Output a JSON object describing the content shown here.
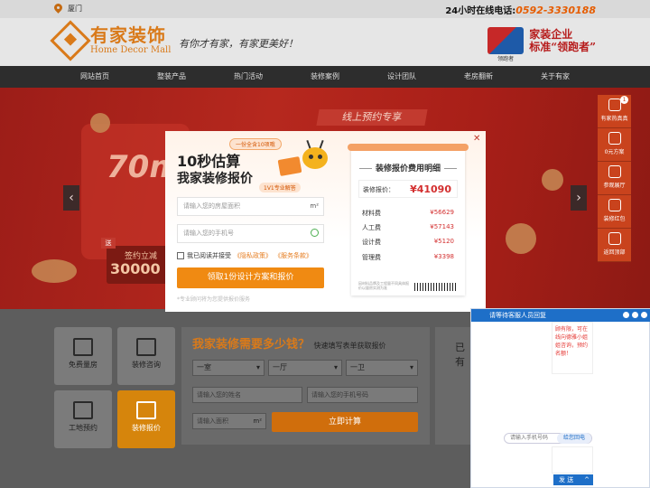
{
  "topbar": {
    "city": "厦门",
    "hotline_label": "24小时在线电话:",
    "hotline_number": "0592-3330188"
  },
  "header": {
    "logo_cn": "有家装饰",
    "logo_en": "Home Decor Mall",
    "slogan": "有你才有家，有家更美好！",
    "badge_caption": "领跑者",
    "badge_line1": "家装企业",
    "badge_line2": "标准“领跑者”"
  },
  "nav": [
    "网站首页",
    "整装产品",
    "热门活动",
    "装修案例",
    "设计团队",
    "老房翻新",
    "关于有家"
  ],
  "banner": {
    "headline": "线上预约专享",
    "big": "70m",
    "sign_small": "签约立减",
    "sign_big": "30000",
    "tag": "送"
  },
  "floatbar": [
    {
      "label": "有家热真真",
      "badge": "1",
      "icon": "headset-icon"
    },
    {
      "label": "0元方案",
      "icon": "edit-icon"
    },
    {
      "label": "参观展厅",
      "icon": "location-icon"
    },
    {
      "label": "装修红包",
      "icon": "gift-icon"
    },
    {
      "label": "返回顶部",
      "icon": "arrow-up-icon"
    }
  ],
  "modal": {
    "tag_top": "一份全含10项哦",
    "title1": "10秒估算",
    "title2": "我家装修报价",
    "tag_expert": "1V1专业解答",
    "area_placeholder": "请输入您的房屋面积",
    "area_unit": "m²",
    "phone_placeholder": "请输入您的手机号",
    "agree_prefix": "我已阅读并接受",
    "privacy": "《隐私政策》",
    "service": "《服务条款》",
    "button": "领取1份设计方案和报价",
    "note": "*专业顾问将为您提供报价服务",
    "receipt": {
      "heading": "装修报价费用明细",
      "quote_label": "装修报价：",
      "quote_value": "¥41090",
      "rows": [
        {
          "label": "材料费",
          "value": "¥56629"
        },
        {
          "label": "人工费",
          "value": "¥57143"
        },
        {
          "label": "设计费",
          "value": "¥5120"
        },
        {
          "label": "管理费",
          "value": "¥3398"
        }
      ],
      "fine_print": "因材料品牌及工程量不同具体报价以量房实测为准"
    }
  },
  "tiles": [
    {
      "label": "免费量房",
      "icon": "house-measure-icon"
    },
    {
      "label": "装修咨询",
      "icon": "consult-icon"
    },
    {
      "label": "工地预约",
      "icon": "construction-icon"
    },
    {
      "label": "装修报价",
      "icon": "yen-icon"
    }
  ],
  "calc": {
    "title": "我家装修需要多少钱？",
    "subtitle": "快速填写表单获取报价",
    "selects": [
      "一室",
      "一厅",
      "一卫"
    ],
    "name_placeholder": "请输入您的姓名",
    "phone_placeholder": "请输入您的手机号码",
    "area_placeholder": "请输入面积",
    "area_unit": "m²",
    "button": "立即计算"
  },
  "side_title": "已有",
  "chat": {
    "header": "请等待客服人员回复",
    "message": "顾有限，可在线向德雅小姐姐咨询，预约名额！",
    "phone_placeholder": "请输入手机号码",
    "phone_button": "给您回电",
    "send": "发 送",
    "send_caret": "^"
  }
}
